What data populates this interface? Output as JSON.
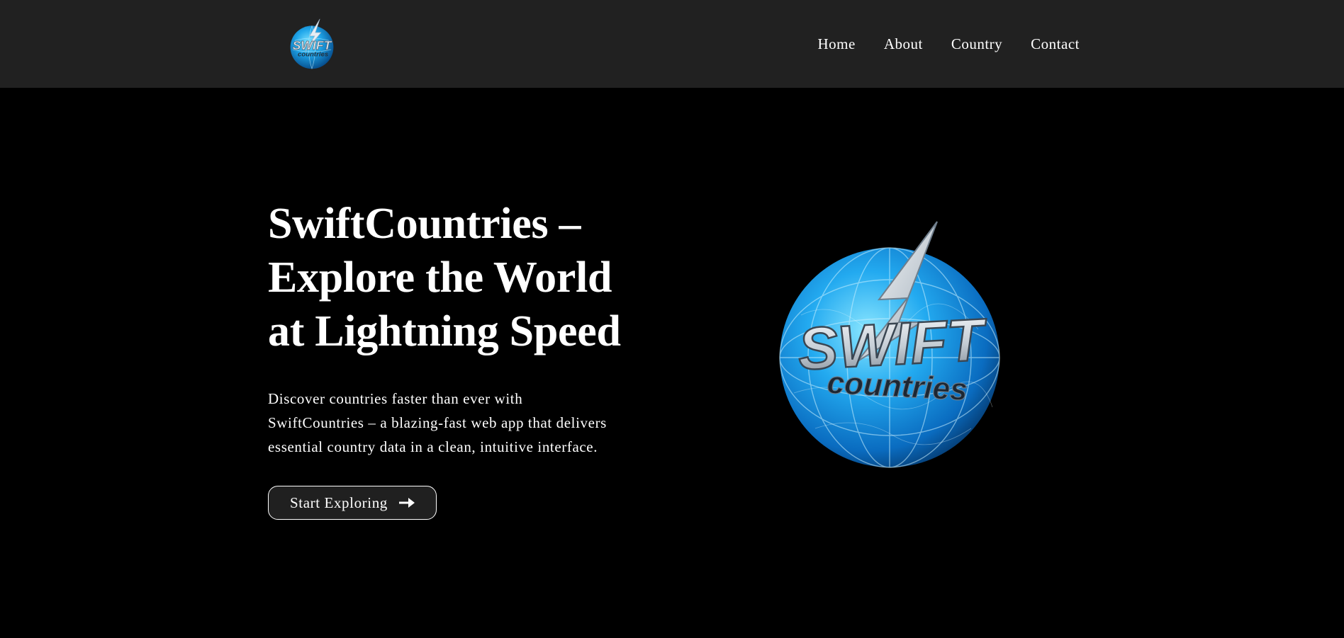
{
  "header": {
    "logo": {
      "line1": "SWIFT",
      "line2": "countries",
      "icon": "swift-countries-globe-logo"
    },
    "nav": [
      {
        "label": "Home"
      },
      {
        "label": "About"
      },
      {
        "label": "Country"
      },
      {
        "label": "Contact"
      }
    ]
  },
  "hero": {
    "title_lines": [
      "SwiftCountries –",
      "Explore the World",
      "at Lightning Speed"
    ],
    "description_lines": [
      "Discover countries faster than ever with",
      "SwiftCountries – a blazing-fast web app that delivers",
      "essential country data in a clean, intuitive interface."
    ],
    "cta_label": "Start Exploring",
    "cta_icon": "arrow-right-icon",
    "image": {
      "line1": "SWIFT",
      "line2": "countries",
      "icon": "swift-countries-globe-logo"
    }
  },
  "colors": {
    "background": "#000000",
    "header": "#212121",
    "globe_light": "#4fd0ff",
    "globe_dark": "#0a5fa8",
    "text": "#ffffff"
  }
}
